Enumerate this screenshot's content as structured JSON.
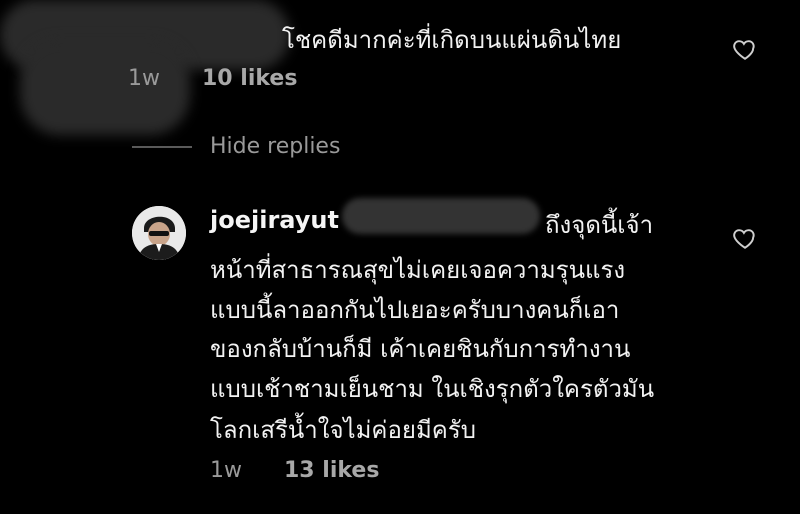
{
  "comment1": {
    "text": "โชคดีมากค่ะที่เกิดบนแผ่นดินไทย",
    "time": "1w",
    "likes": "10 likes",
    "heart_icon": "heart-outline-icon"
  },
  "replies_toggle": {
    "label": "Hide replies"
  },
  "reply": {
    "username": "joejirayut",
    "lines": [
      "ถึงจุดนี้เจ้า",
      "หน้าที่สาธารณสุขไม่เคยเจอความรุนแรง",
      "แบบนี้ลาออกกันไปเยอะครับบางคนก็เอา",
      "ของกลับบ้านก็มี  เค้าเคยชินกับการทำงาน",
      "แบบเช้าชามเย็นชาม  ในเชิงรุกตัวใครตัวมัน",
      "โลกเสรีน้ำใจไม่ค่อยมีครับ"
    ],
    "time": "1w",
    "likes": "13 likes",
    "heart_icon": "heart-outline-icon"
  },
  "colors": {
    "background": "#000000",
    "text": "#f5f5f5",
    "muted": "#9a9a9a"
  }
}
